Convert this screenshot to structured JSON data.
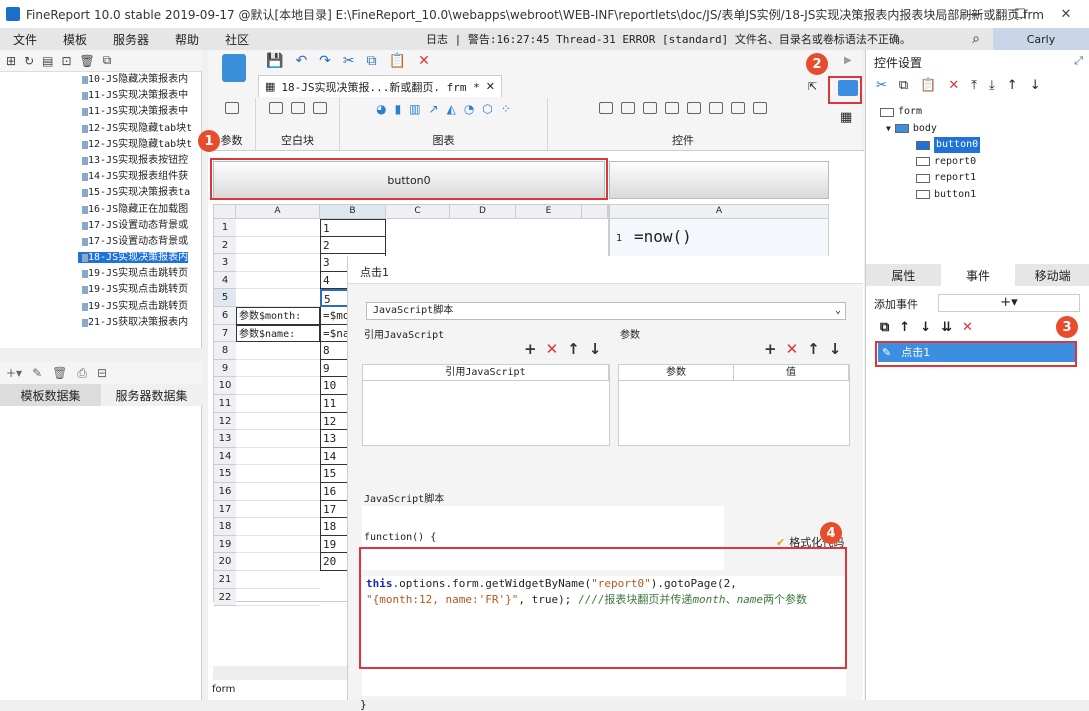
{
  "window": {
    "title": "FineReport 10.0 stable 2019-09-17 @默认[本地目录]   E:\\FineReport_10.0\\webapps\\webroot\\WEB-INF\\reportlets\\doc/JS/表单JS实例/18-JS实现决策报表内报表块局部刷新或翻页.frm",
    "min": "—",
    "max": "☐",
    "close": "✕"
  },
  "menu": [
    "文件",
    "模板",
    "服务器",
    "帮助",
    "社区"
  ],
  "log": "日志 | 警告:16:27:45 Thread-31 ERROR [standard] 文件名、目录名或卷标语法不正确。",
  "user": "Carly",
  "tree": [
    "10-JS隐藏决策报表内",
    "11-JS实现决策报表中",
    "11-JS实现决策报表中",
    "12-JS实现隐藏tab块t",
    "12-JS实现隐藏tab块t",
    "13-JS实现报表按钮控",
    "14-JS实现报表组件获",
    "15-JS实现决策报表ta",
    "16-JS隐藏正在加载图",
    "17-JS设置动态背景或",
    "17-JS设置动态背景或",
    "18-JS实现决策报表内",
    "19-JS实现点击跳转页",
    "19-JS实现点击跳转页",
    "19-JS实现点击跳转页",
    "21-JS获取决策报表内"
  ],
  "tree_selected": 11,
  "datasets": {
    "tab1": "模板数据集",
    "tab2": "服务器数据集"
  },
  "doc_tab": "18-JS实现决策报...新或翻页. frm *",
  "ribbon": {
    "param": "参数",
    "blank": "空白块",
    "chart": "图表",
    "widget": "控件"
  },
  "button0": "button0",
  "grid": {
    "cols": [
      "A",
      "B",
      "C",
      "D",
      "E"
    ],
    "rcol": "A",
    "rows": [
      {
        "n": "1",
        "a": "",
        "b": "1"
      },
      {
        "n": "2",
        "a": "",
        "b": "2"
      },
      {
        "n": "3",
        "a": "",
        "b": "3"
      },
      {
        "n": "4",
        "a": "",
        "b": "4"
      },
      {
        "n": "5",
        "a": "",
        "b": "5"
      },
      {
        "n": "6",
        "a": "参数$month:",
        "b": "=$mo"
      },
      {
        "n": "7",
        "a": "参数$name:",
        "b": "=$na"
      },
      {
        "n": "8",
        "a": "",
        "b": "8"
      },
      {
        "n": "9",
        "a": "",
        "b": "9"
      },
      {
        "n": "10",
        "a": "",
        "b": "10"
      },
      {
        "n": "11",
        "a": "",
        "b": "11"
      },
      {
        "n": "12",
        "a": "",
        "b": "12"
      },
      {
        "n": "13",
        "a": "",
        "b": "13"
      },
      {
        "n": "14",
        "a": "",
        "b": "14"
      },
      {
        "n": "15",
        "a": "",
        "b": "15"
      },
      {
        "n": "16",
        "a": "",
        "b": "16"
      },
      {
        "n": "17",
        "a": "",
        "b": "17"
      },
      {
        "n": "18",
        "a": "",
        "b": "18"
      },
      {
        "n": "19",
        "a": "",
        "b": "19"
      },
      {
        "n": "20",
        "a": "",
        "b": "20"
      },
      {
        "n": "21",
        "a": "",
        "b": ""
      },
      {
        "n": "22",
        "a": "",
        "b": ""
      }
    ],
    "rformula_n": "1",
    "rformula": "=now()"
  },
  "dialog": {
    "title": "点击1",
    "type": "JavaScript脚本",
    "ref_label": "引用JavaScript",
    "param_label": "参数",
    "ref_col": "引用JavaScript",
    "p_col1": "参数",
    "p_col2": "值",
    "script_label": "JavaScript脚本",
    "fn": "function() {",
    "format": "格式化代码",
    "end": "}",
    "code1a": "this",
    "code1b": ".options.form.getWidgetByName(",
    "code1c": "\"report0\"",
    "code1d": ").gotoPage(2,",
    "code2a": "\"{month:12, name:'FR'}\"",
    "code2b": ", true); ",
    "code2c": "////报表块翻页并传递",
    "code2d": "month",
    "code2e": "、",
    "code2f": "name",
    "code2g": "两个参数"
  },
  "right": {
    "title": "控件设置",
    "nodes": [
      "form",
      "body",
      "button0",
      "report0",
      "report1",
      "button1"
    ],
    "tabs": [
      "属性",
      "事件",
      "移动端"
    ],
    "add_event": "添加事件",
    "add_btn": "+▾",
    "event": "点击1"
  },
  "badges": [
    "1",
    "2",
    "3",
    "4"
  ],
  "status": "form"
}
